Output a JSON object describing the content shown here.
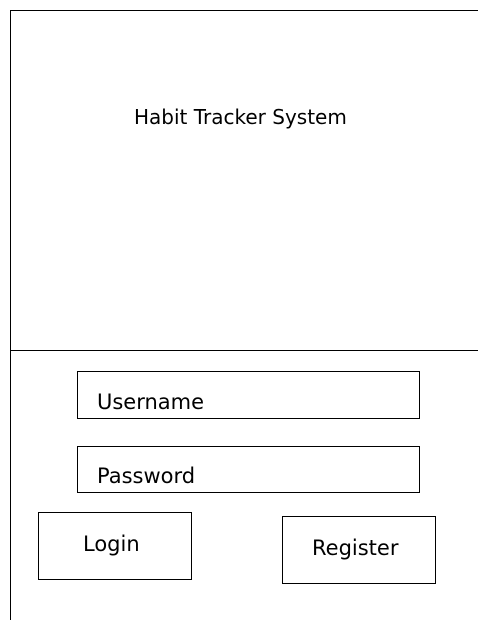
{
  "app": {
    "title": "Habit Tracker System"
  },
  "login_form": {
    "username_label": "Username",
    "password_label": "Password",
    "login_label": "Login",
    "register_label": "Register"
  }
}
